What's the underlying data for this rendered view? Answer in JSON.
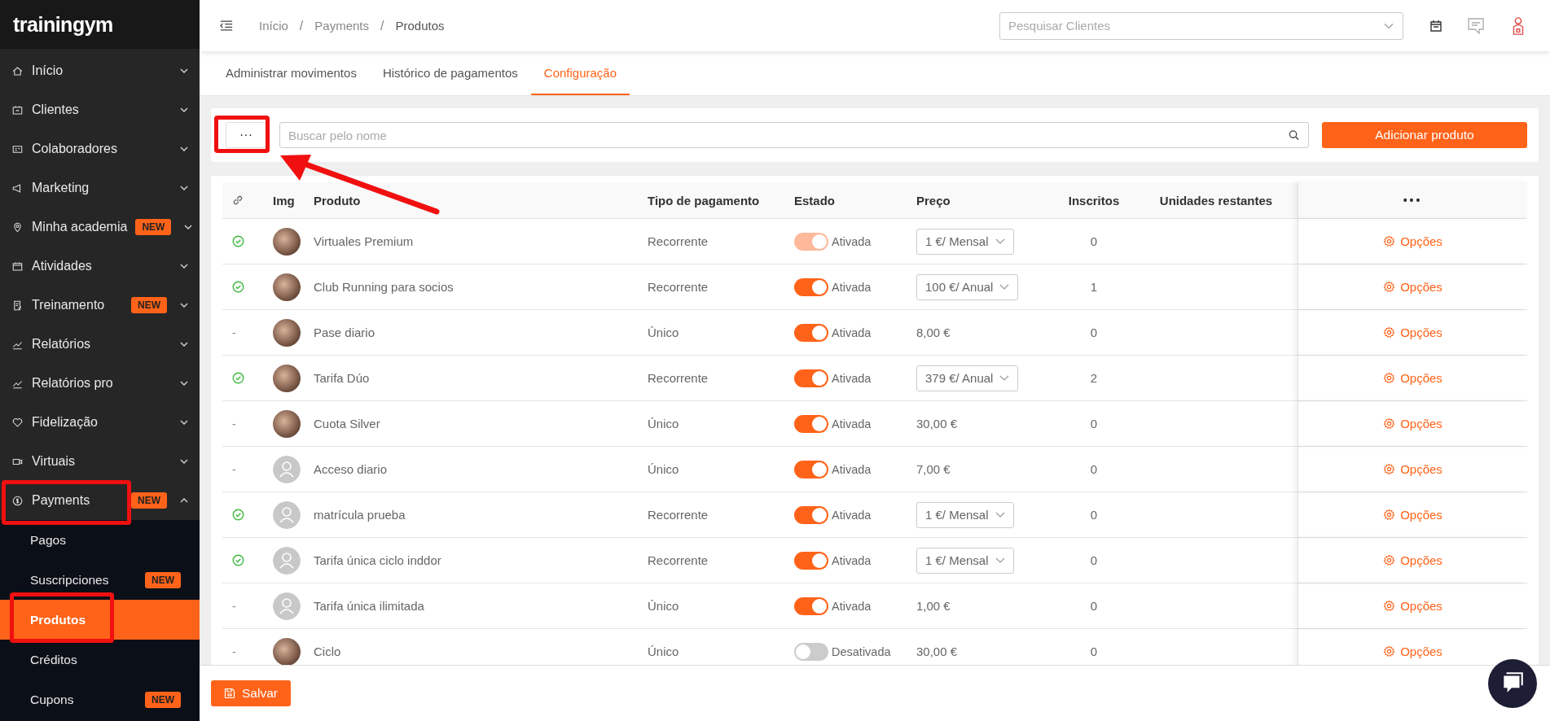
{
  "brand": "trainingym",
  "sidebar": {
    "items": [
      {
        "label": "Início",
        "expanded": false
      },
      {
        "label": "Clientes",
        "expanded": false
      },
      {
        "label": "Colaboradores",
        "expanded": false
      },
      {
        "label": "Marketing",
        "expanded": false
      },
      {
        "label": "Minha academia",
        "badge": "NEW",
        "expanded": false
      },
      {
        "label": "Atividades",
        "expanded": false
      },
      {
        "label": "Treinamento",
        "badge": "NEW",
        "expanded": false
      },
      {
        "label": "Relatórios",
        "expanded": false
      },
      {
        "label": "Relatórios pro",
        "expanded": false
      },
      {
        "label": "Fidelização",
        "expanded": false
      },
      {
        "label": "Virtuais",
        "expanded": false
      },
      {
        "label": "Payments",
        "badge": "NEW",
        "expanded": true,
        "children": [
          {
            "label": "Pagos",
            "selected": false
          },
          {
            "label": "Suscripciones",
            "badge": "NEW",
            "selected": false
          },
          {
            "label": "Produtos",
            "selected": true
          },
          {
            "label": "Créditos",
            "selected": false
          },
          {
            "label": "Cupons",
            "badge": "NEW",
            "selected": false
          }
        ]
      }
    ]
  },
  "breadcrumbs": [
    {
      "label": "Início"
    },
    {
      "separator": "/",
      "label": "Payments"
    },
    {
      "separator": "/",
      "label": "Produtos"
    }
  ],
  "client_search": {
    "placeholder": "Pesquisar Clientes"
  },
  "tabs": [
    {
      "label": "Administrar movimentos",
      "selected": false
    },
    {
      "label": "Histórico de pagamentos",
      "selected": false
    },
    {
      "label": "Configuração",
      "selected": true
    }
  ],
  "toolbar": {
    "more_label": "···",
    "search": {
      "placeholder": "Buscar pelo nome"
    },
    "add_button": "Adicionar produto"
  },
  "table": {
    "columns": [
      "Img",
      "Produto",
      "Tipo de pagamento",
      "Estado",
      "Preço",
      "Inscritos",
      "Unidades restantes"
    ],
    "menu_label": "•••",
    "rows": [
      {
        "linked": true,
        "has_photo": true,
        "product": "Virtuales Premium",
        "payment_type": "Recorrente",
        "active": true,
        "disabled": true,
        "status": "Ativada",
        "price": {
          "kind": "select",
          "text": "1 €/ Mensal"
        },
        "enrolled": "0",
        "action": "Opções"
      },
      {
        "linked": true,
        "has_photo": true,
        "product": "Club Running para socios",
        "payment_type": "Recorrente",
        "active": true,
        "disabled": false,
        "status": "Ativada",
        "price": {
          "kind": "select",
          "text": "100 €/ Anual"
        },
        "enrolled": "1",
        "action": "Opções"
      },
      {
        "linked": false,
        "link_text": "-",
        "has_photo": true,
        "product": "Pase diario",
        "payment_type": "Único",
        "active": true,
        "disabled": false,
        "status": "Ativada",
        "price": {
          "kind": "text",
          "text": "8,00 €"
        },
        "enrolled": "0",
        "action": "Opções"
      },
      {
        "linked": true,
        "has_photo": true,
        "product": "Tarifa Dúo",
        "payment_type": "Recorrente",
        "active": true,
        "disabled": false,
        "status": "Ativada",
        "price": {
          "kind": "select",
          "text": "379 €/ Anual"
        },
        "enrolled": "2",
        "action": "Opções"
      },
      {
        "linked": false,
        "link_text": "-",
        "has_photo": true,
        "product": "Cuota Silver",
        "payment_type": "Único",
        "active": true,
        "disabled": false,
        "status": "Ativada",
        "price": {
          "kind": "text",
          "text": "30,00 €"
        },
        "enrolled": "0",
        "action": "Opções"
      },
      {
        "linked": false,
        "link_text": "-",
        "has_photo": false,
        "product": "Acceso diario",
        "payment_type": "Único",
        "active": true,
        "disabled": false,
        "status": "Ativada",
        "price": {
          "kind": "text",
          "text": "7,00 €"
        },
        "enrolled": "0",
        "action": "Opções"
      },
      {
        "linked": true,
        "has_photo": false,
        "product": "matrícula prueba",
        "payment_type": "Recorrente",
        "active": true,
        "disabled": false,
        "status": "Ativada",
        "price": {
          "kind": "select",
          "text": "1 €/ Mensal"
        },
        "enrolled": "0",
        "action": "Opções"
      },
      {
        "linked": true,
        "has_photo": false,
        "product": "Tarifa única ciclo inddor",
        "payment_type": "Recorrente",
        "active": true,
        "disabled": false,
        "status": "Ativada",
        "price": {
          "kind": "select",
          "text": "1 €/ Mensal"
        },
        "enrolled": "0",
        "action": "Opções"
      },
      {
        "linked": false,
        "link_text": "-",
        "has_photo": false,
        "product": "Tarifa única ilimitada",
        "payment_type": "Único",
        "active": true,
        "disabled": false,
        "status": "Ativada",
        "price": {
          "kind": "text",
          "text": "1,00 €"
        },
        "enrolled": "0",
        "action": "Opções"
      },
      {
        "linked": false,
        "link_text": "-",
        "has_photo": true,
        "product": "Ciclo",
        "payment_type": "Único",
        "active": false,
        "disabled": false,
        "status": "Desativada",
        "price": {
          "kind": "text",
          "text": "30,00 €"
        },
        "enrolled": "0",
        "action": "Opções"
      }
    ]
  },
  "footer": {
    "save_button": "Salvar"
  }
}
